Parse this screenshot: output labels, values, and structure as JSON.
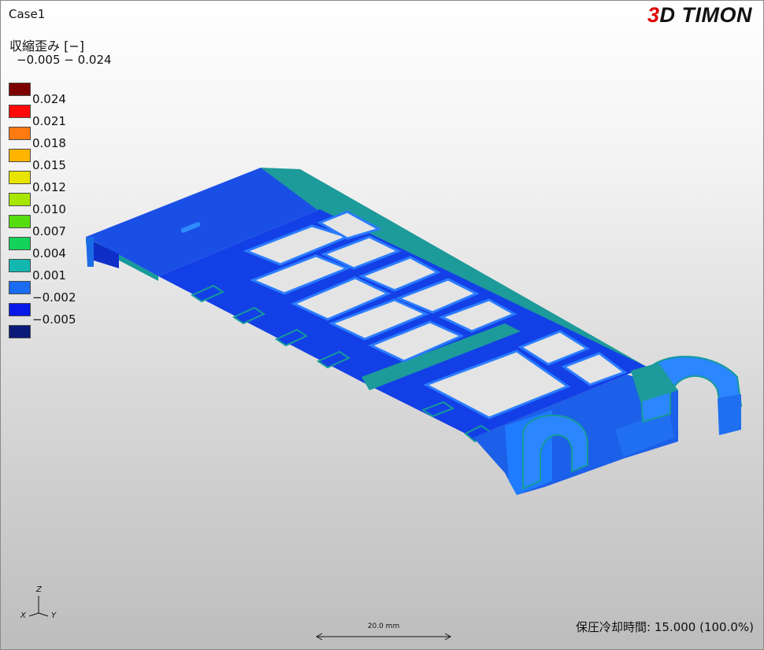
{
  "case": {
    "title": "Case1"
  },
  "logo": {
    "prefix": "3",
    "suffix": "D TIMON"
  },
  "result": {
    "name": "収縮歪み [−]",
    "range": "−0.005 − 0.024"
  },
  "legend": {
    "entries": [
      {
        "label": "0.024",
        "color": "#7d0000"
      },
      {
        "label": "0.021",
        "color": "#ff0a0a"
      },
      {
        "label": "0.018",
        "color": "#ff7a10"
      },
      {
        "label": "0.015",
        "color": "#ffb400"
      },
      {
        "label": "0.012",
        "color": "#e8e400"
      },
      {
        "label": "0.010",
        "color": "#a6e600"
      },
      {
        "label": "0.007",
        "color": "#55dd10"
      },
      {
        "label": "0.004",
        "color": "#14d25a"
      },
      {
        "label": "0.001",
        "color": "#12b8b0"
      },
      {
        "label": "−0.002",
        "color": "#1a6cf2"
      },
      {
        "label": "−0.005",
        "color": "#0818e6"
      },
      {
        "label": "",
        "color": "#0a1a78"
      }
    ]
  },
  "axes": {
    "z": "Z",
    "x": "X",
    "y": "Y"
  },
  "scale": {
    "label": "20.0 mm"
  },
  "status": {
    "text": "保圧冷却時間: 15.000 (100.0%)"
  },
  "colors": {
    "part_base": "#1a45e6",
    "part_teal": "#1d9a9a",
    "part_bright": "#2a8bff",
    "part_dark": "#0c1fb8"
  }
}
